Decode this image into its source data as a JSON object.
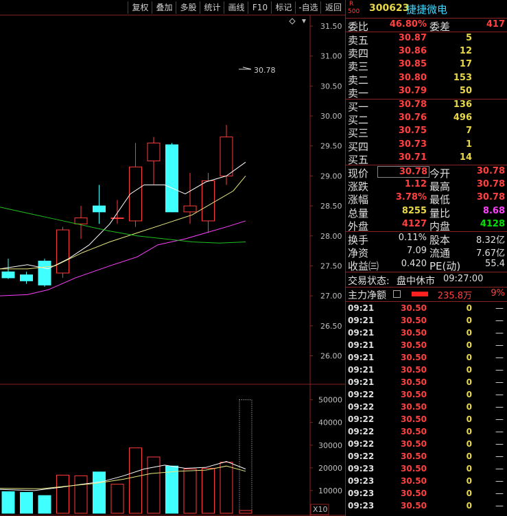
{
  "toolbar": {
    "buttons": [
      "复权",
      "叠加",
      "多股",
      "统计",
      "画线",
      "F10",
      "标记",
      "-自选",
      "返回"
    ]
  },
  "chart": {
    "price_ticks": [
      "31.50",
      "31.00",
      "30.50",
      "30.00",
      "29.50",
      "29.00",
      "28.50",
      "28.00",
      "27.50",
      "27.00",
      "26.50",
      "26.00"
    ],
    "vol_ticks": [
      "50000",
      "40000",
      "30000",
      "20000",
      "10000"
    ],
    "vol_unit": "X10",
    "last_price_label": "30.78",
    "colors": {
      "up": "#ff3b3b",
      "down": "#40ffff",
      "ma5": "#ffffff",
      "ma10": "#e8e880",
      "ma20": "#ff40ff",
      "ma60": "#20c020"
    }
  },
  "chart_data": {
    "type": "candlestick",
    "ylim": [
      25.6,
      31.6
    ],
    "candles": [
      {
        "o": 27.4,
        "h": 27.62,
        "l": 27.28,
        "c": 27.3
      },
      {
        "o": 27.35,
        "h": 27.4,
        "l": 27.2,
        "c": 27.25
      },
      {
        "o": 27.58,
        "h": 27.62,
        "l": 27.15,
        "c": 27.18
      },
      {
        "o": 27.38,
        "h": 28.15,
        "l": 27.3,
        "c": 28.1
      },
      {
        "o": 28.2,
        "h": 28.5,
        "l": 27.95,
        "c": 28.3
      },
      {
        "o": 28.5,
        "h": 28.85,
        "l": 28.2,
        "c": 28.4
      },
      {
        "o": 28.3,
        "h": 28.6,
        "l": 28.2,
        "c": 28.3
      },
      {
        "o": 28.25,
        "h": 29.55,
        "l": 28.15,
        "c": 29.15
      },
      {
        "o": 29.25,
        "h": 29.65,
        "l": 28.85,
        "c": 29.55
      },
      {
        "o": 29.52,
        "h": 29.55,
        "l": 28.4,
        "c": 28.4
      },
      {
        "o": 28.4,
        "h": 29.05,
        "l": 28.2,
        "c": 28.5
      },
      {
        "o": 28.25,
        "h": 29.05,
        "l": 28.05,
        "c": 28.92
      },
      {
        "o": 29.0,
        "h": 29.85,
        "l": 28.85,
        "c": 29.65
      },
      {
        "o": 30.78,
        "h": 30.78,
        "l": 30.78,
        "c": 30.78
      }
    ],
    "volumes": [
      9500,
      9200,
      7800,
      16800,
      16500,
      18200,
      12800,
      28800,
      24800,
      20800,
      19500,
      19800,
      22500,
      50000
    ],
    "vol_ylim": [
      0,
      52000
    ]
  },
  "quote": {
    "code": "300623",
    "name": "捷捷微电",
    "badge_top": "R",
    "badge_bottom": "500",
    "weibi_label": "委比",
    "weibi_value": "46.80%",
    "weicha_label": "委差",
    "weicha_value": "417",
    "asks": [
      {
        "label": "卖五",
        "price": "30.87",
        "vol": "5"
      },
      {
        "label": "卖四",
        "price": "30.86",
        "vol": "12"
      },
      {
        "label": "卖三",
        "price": "30.85",
        "vol": "17"
      },
      {
        "label": "卖二",
        "price": "30.80",
        "vol": "153"
      },
      {
        "label": "卖一",
        "price": "30.79",
        "vol": "50"
      }
    ],
    "bids": [
      {
        "label": "买一",
        "price": "30.78",
        "vol": "136"
      },
      {
        "label": "买二",
        "price": "30.76",
        "vol": "496"
      },
      {
        "label": "买三",
        "price": "30.75",
        "vol": "7"
      },
      {
        "label": "买四",
        "price": "30.73",
        "vol": "1"
      },
      {
        "label": "买五",
        "price": "30.71",
        "vol": "14"
      }
    ],
    "stats": [
      {
        "l1": "现价",
        "v1": "30.78",
        "l2": "今开",
        "v2": "30.78"
      },
      {
        "l1": "涨跌",
        "v1": "1.12",
        "l2": "最高",
        "v2": "30.78"
      },
      {
        "l1": "涨幅",
        "v1": "3.78%",
        "l2": "最低",
        "v2": "30.78"
      },
      {
        "l1": "总量",
        "v1": "8255",
        "l2": "量比",
        "v2": "8.68"
      },
      {
        "l1": "外盘",
        "v1": "4127",
        "l2": "内盘",
        "v2": "4128"
      }
    ],
    "stats2": [
      {
        "l1": "换手",
        "v1": "0.11%",
        "l2": "股本",
        "v2": "8.32亿"
      },
      {
        "l1": "净资",
        "v1": "7.09",
        "l2": "流通",
        "v2": "7.67亿"
      },
      {
        "l1": "收益㈢",
        "v1": "0.420",
        "l2": "PE(动)",
        "v2": "55.4"
      }
    ],
    "status_label": "交易状态:",
    "status_value": "盘中休市",
    "status_time": "09:27:00",
    "fund_label": "主力净额",
    "fund_value": "235.8万",
    "fund_pct": "9%"
  },
  "ticks": [
    {
      "t": "09:21",
      "p": "30.50",
      "v": "0",
      "d": "—"
    },
    {
      "t": "09:21",
      "p": "30.50",
      "v": "0",
      "d": "—"
    },
    {
      "t": "09:21",
      "p": "30.50",
      "v": "0",
      "d": "—"
    },
    {
      "t": "09:21",
      "p": "30.50",
      "v": "0",
      "d": "—"
    },
    {
      "t": "09:21",
      "p": "30.50",
      "v": "0",
      "d": "—"
    },
    {
      "t": "09:21",
      "p": "30.50",
      "v": "0",
      "d": "—"
    },
    {
      "t": "09:21",
      "p": "30.50",
      "v": "0",
      "d": "—"
    },
    {
      "t": "09:22",
      "p": "30.50",
      "v": "0",
      "d": "—"
    },
    {
      "t": "09:22",
      "p": "30.50",
      "v": "0",
      "d": "—"
    },
    {
      "t": "09:22",
      "p": "30.50",
      "v": "0",
      "d": "—"
    },
    {
      "t": "09:22",
      "p": "30.50",
      "v": "0",
      "d": "—"
    },
    {
      "t": "09:22",
      "p": "30.50",
      "v": "0",
      "d": "—"
    },
    {
      "t": "09:22",
      "p": "30.50",
      "v": "0",
      "d": "—"
    },
    {
      "t": "09:23",
      "p": "30.50",
      "v": "0",
      "d": "—"
    },
    {
      "t": "09:23",
      "p": "30.50",
      "v": "0",
      "d": "—"
    },
    {
      "t": "09:23",
      "p": "30.50",
      "v": "0",
      "d": "—"
    },
    {
      "t": "09:23",
      "p": "30.50",
      "v": "0",
      "d": "—"
    }
  ]
}
